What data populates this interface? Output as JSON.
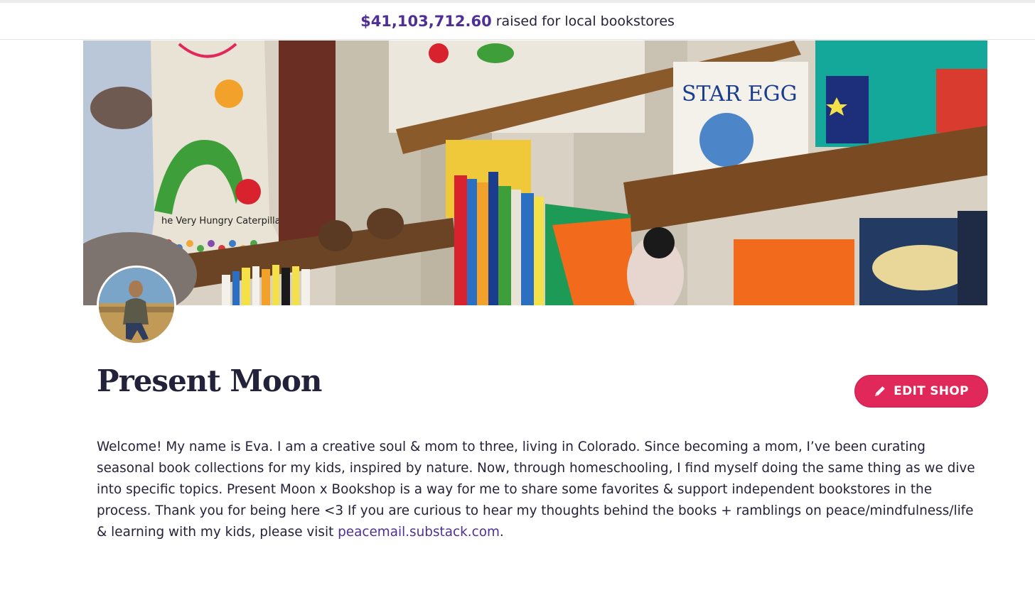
{
  "header": {
    "raised_amount": "$41,103,712.60",
    "raised_text": "raised for local bookstores"
  },
  "banner": {
    "book_title_1": "STAR EGG",
    "caterpillar_caption": "he Very Hungry Caterpillar"
  },
  "shop": {
    "title": "Present Moon",
    "edit_button_label": "EDIT SHOP",
    "bio_text": "Welcome! My name is Eva. I am a creative soul & mom to three, living in Colorado.  Since becoming a mom, I’ve been curating seasonal book collections for my kids, inspired by nature. Now, through homeschooling, I find myself doing the same thing as we dive into specific topics. Present Moon x Bookshop is a way for me to share some favorites & support independent bookstores in the process. Thank you for being here <3 If you are curious to hear my thoughts behind the books + ramblings on peace/mindfulness/life & learning with my kids, please visit ",
    "bio_link": "peacemail.substack.com",
    "bio_end": "."
  },
  "colors": {
    "accent_purple": "#4f2f96",
    "button_pink": "#e0295a"
  },
  "icons": {
    "edit": "pencil-icon"
  }
}
